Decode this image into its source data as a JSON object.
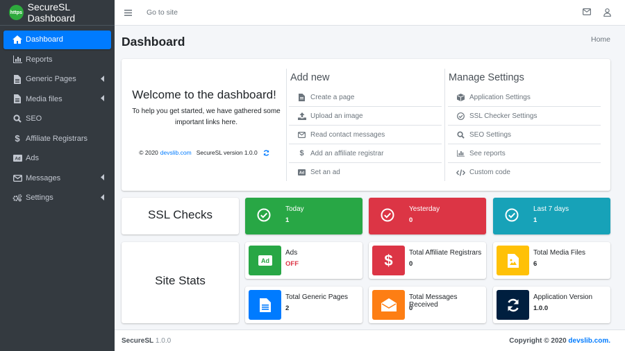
{
  "brand": {
    "logo_text": "https",
    "title": "SecureSL Dashboard"
  },
  "sidebar": {
    "items": [
      {
        "label": "Dashboard",
        "icon": "home-icon",
        "active": true
      },
      {
        "label": "Reports",
        "icon": "chart-icon"
      },
      {
        "label": "Generic Pages",
        "icon": "file-icon",
        "has_submenu": true
      },
      {
        "label": "Media files",
        "icon": "file-icon",
        "has_submenu": true
      },
      {
        "label": "SEO",
        "icon": "search-icon"
      },
      {
        "label": "Affiliate Registrars",
        "icon": "dollar-icon"
      },
      {
        "label": "Ads",
        "icon": "ad-icon"
      },
      {
        "label": "Messages",
        "icon": "envelope-icon",
        "has_submenu": true
      },
      {
        "label": "Settings",
        "icon": "cogs-icon",
        "has_submenu": true
      }
    ]
  },
  "topbar": {
    "goto_label": "Go to site",
    "icons": [
      "menu-icon",
      "envelope-icon",
      "user-icon"
    ]
  },
  "page": {
    "title": "Dashboard",
    "breadcrumb": "Home"
  },
  "welcome": {
    "title": "Welcome to the dashboard!",
    "text": "To help you get started, we have gathered some important links here.",
    "footer_prefix": "© 2020",
    "footer_link": "devslib.com",
    "footer_version": "SecureSL version 1.0.0"
  },
  "add_new": {
    "title": "Add new",
    "links": [
      {
        "label": "Create a page",
        "icon": "file-icon"
      },
      {
        "label": "Upload an image",
        "icon": "upload-icon"
      },
      {
        "label": "Read contact messages",
        "icon": "envelope-icon"
      },
      {
        "label": "Add an affiliate registrar",
        "icon": "dollar-icon"
      },
      {
        "label": "Set an ad",
        "icon": "ad-icon"
      }
    ]
  },
  "manage": {
    "title": "Manage Settings",
    "links": [
      {
        "label": "Application Settings",
        "icon": "cube-icon"
      },
      {
        "label": "SSL Checker Settings",
        "icon": "check-circle-icon"
      },
      {
        "label": "SEO Settings",
        "icon": "search-icon"
      },
      {
        "label": "See reports",
        "icon": "chart-icon"
      },
      {
        "label": "Custom code",
        "icon": "code-icon"
      }
    ]
  },
  "ssl": {
    "title": "SSL Checks",
    "boxes": [
      {
        "label": "Today",
        "value": "1",
        "color": "#28a745"
      },
      {
        "label": "Yesterday",
        "value": "0",
        "color": "#dc3545"
      },
      {
        "label": "Last 7 days",
        "value": "1",
        "color": "#17a2b8"
      }
    ]
  },
  "stats": {
    "title": "Site Stats",
    "boxes": [
      {
        "label": "Ads",
        "value": "OFF",
        "color": "#28a745",
        "value_color": "#dc3545",
        "icon": "ad-icon"
      },
      {
        "label": "Total Affiliate Registrars",
        "value": "0",
        "color": "#dc3545",
        "icon": "dollar-icon"
      },
      {
        "label": "Total Media Files",
        "value": "6",
        "color": "#ffc107",
        "icon": "file-image-icon"
      },
      {
        "label": "Total Generic Pages",
        "value": "2",
        "color": "#007bff",
        "icon": "file-alt-icon"
      },
      {
        "label": "Total Messages Received",
        "value": "0",
        "color": "#fd7e14",
        "icon": "envelope-open-icon"
      },
      {
        "label": "Application Version",
        "value": "1.0.0",
        "color": "#001f3f",
        "icon": "sync-icon"
      }
    ]
  },
  "footer": {
    "brand": "SecureSL",
    "version": "1.0.0",
    "copyright": "Copyright © 2020",
    "link": "devslib.com."
  }
}
